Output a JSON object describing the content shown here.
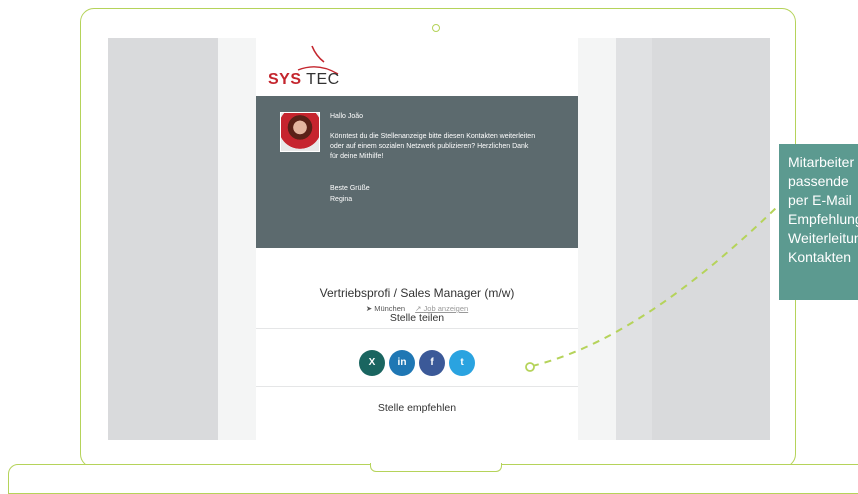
{
  "logo": {
    "sys": "SYS",
    "tec": "TEC"
  },
  "message": {
    "greeting": "Hallo João",
    "body_line1": "Könntest du die Stellenanzeige bitte diesen Kontakten weiterleiten",
    "body_line2": "oder auf einem sozialen Netzwerk publizieren? Herzlichen Dank",
    "body_line3": "für deine Mithilfe!",
    "closing": "Beste Grüße",
    "signature": "Regina"
  },
  "job": {
    "title": "Vertriebsprofi / Sales Manager (m/w)",
    "location_icon": "location-arrow-icon",
    "location": "München",
    "link_icon": "external-link-icon",
    "link_label": "Job anzeigen"
  },
  "share": {
    "title": "Stelle teilen",
    "buttons": [
      {
        "network": "xing",
        "icon": "xing-icon",
        "glyph": "X",
        "color": "#1a6560"
      },
      {
        "network": "linkedin",
        "icon": "linkedin-icon",
        "glyph": "in",
        "color": "#1f77b4"
      },
      {
        "network": "facebook",
        "icon": "facebook-icon",
        "glyph": "f",
        "color": "#3b5998"
      },
      {
        "network": "twitter",
        "icon": "twitter-icon",
        "glyph": "t",
        "color": "#2aa3e0"
      }
    ]
  },
  "recommend": {
    "title": "Stelle empfehlen"
  },
  "callout": {
    "lines": [
      "Mitarbeiter",
      "passende",
      "per E-Mail",
      "Empfehlung",
      "Weiterleitung",
      "Kontakten"
    ]
  },
  "colors": {
    "accent_green": "#b5d35a",
    "callout_teal": "#5c9a90",
    "message_bg": "#5c6a6e",
    "brand_red": "#c4262e"
  }
}
